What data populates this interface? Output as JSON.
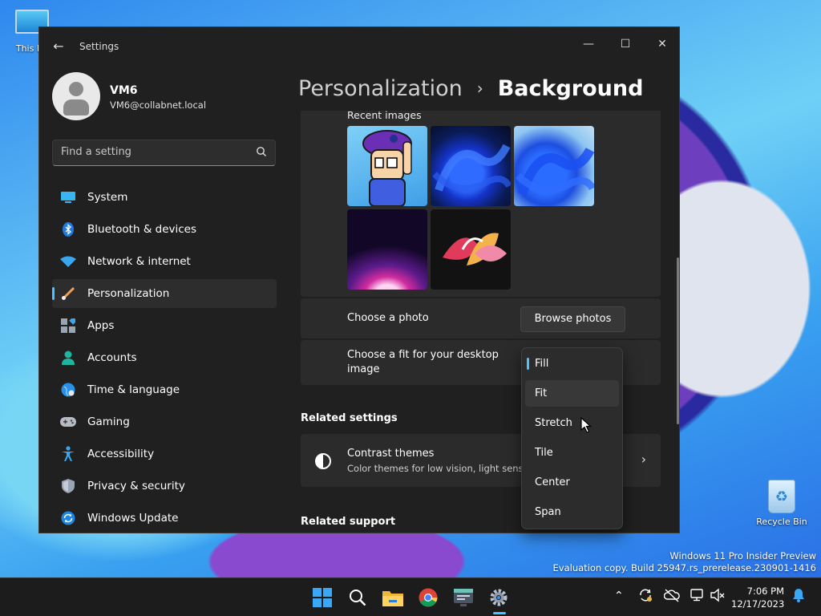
{
  "desktop": {
    "this_pc_label": "This PC",
    "recycle_bin_label": "Recycle Bin",
    "watermark_line1": "Windows 11 Pro Insider Preview",
    "watermark_line2": "Evaluation copy. Build 25947.rs_prerelease.230901-1416"
  },
  "window": {
    "title": "Settings",
    "controls": {
      "minimize": "—",
      "maximize": "☐",
      "close": "✕"
    }
  },
  "profile": {
    "name": "VM6",
    "email": "VM6@collabnet.local"
  },
  "search": {
    "placeholder": "Find a setting"
  },
  "nav": {
    "items": [
      {
        "label": "System",
        "icon": "system-icon"
      },
      {
        "label": "Bluetooth & devices",
        "icon": "bluetooth-icon"
      },
      {
        "label": "Network & internet",
        "icon": "wifi-icon"
      },
      {
        "label": "Personalization",
        "icon": "brush-icon",
        "active": true
      },
      {
        "label": "Apps",
        "icon": "apps-icon"
      },
      {
        "label": "Accounts",
        "icon": "accounts-icon"
      },
      {
        "label": "Time & language",
        "icon": "globe-icon"
      },
      {
        "label": "Gaming",
        "icon": "gamepad-icon"
      },
      {
        "label": "Accessibility",
        "icon": "accessibility-icon"
      },
      {
        "label": "Privacy & security",
        "icon": "shield-icon"
      },
      {
        "label": "Windows Update",
        "icon": "update-icon"
      }
    ]
  },
  "breadcrumb": {
    "parent": "Personalization",
    "current": "Background"
  },
  "background": {
    "recent_images_label": "Recent images",
    "choose_photo_label": "Choose a photo",
    "browse_button": "Browse photos",
    "fit_label": "Choose a fit for your desktop image",
    "fit_options": [
      "Fill",
      "Fit",
      "Stretch",
      "Tile",
      "Center",
      "Span"
    ],
    "fit_selected": "Fill",
    "fit_hover": "Fit"
  },
  "related_settings": {
    "heading": "Related settings",
    "contrast_title": "Contrast themes",
    "contrast_desc": "Color themes for low vision, light sensiti"
  },
  "related_support": {
    "heading": "Related support"
  },
  "taskbar": {
    "clock_time": "7:06 PM",
    "clock_date": "12/17/2023",
    "apps": [
      "start-icon",
      "search-icon",
      "file-explorer-icon",
      "chrome-icon",
      "terminal-icon",
      "settings-icon"
    ]
  },
  "colors": {
    "accent": "#4cc2ff",
    "window_bg": "#202020",
    "card_bg": "#2b2b2b"
  }
}
